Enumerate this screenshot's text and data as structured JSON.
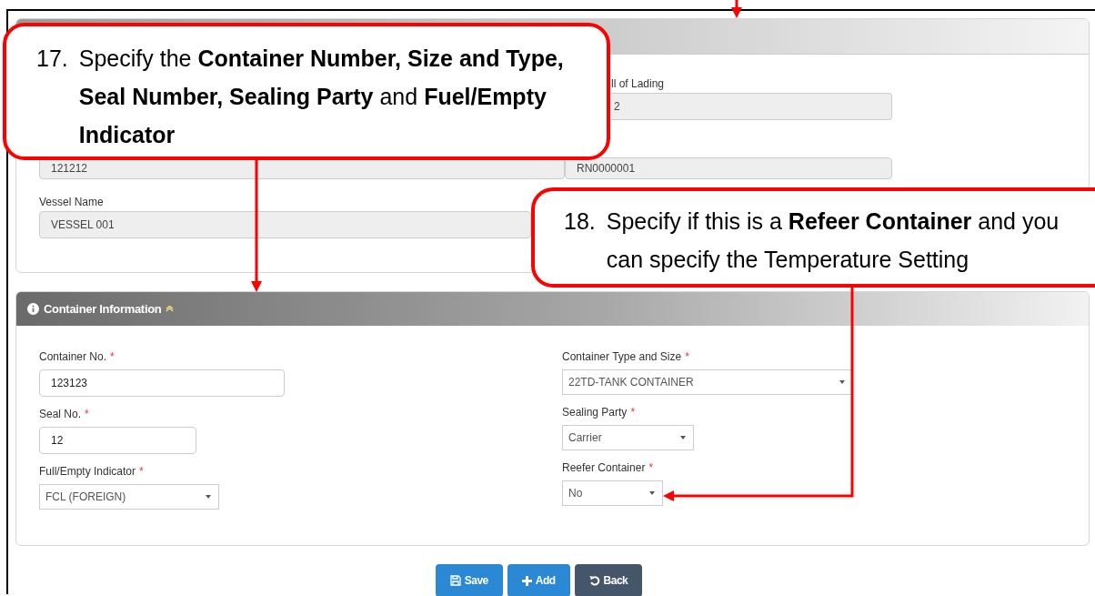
{
  "details_panel": {
    "rows": [
      {
        "right": {
          "label": "ll of Lading",
          "value": "2"
        }
      },
      {
        "left": {
          "value": "121212"
        },
        "right": {
          "value": "RN0000001"
        }
      },
      {
        "wide": {
          "label": "Vessel Name",
          "value": "VESSEL 001"
        }
      }
    ]
  },
  "container_panel": {
    "title": "Container Information",
    "expanded": true,
    "left_fields": [
      {
        "label": "Container No.",
        "required_mark": "*",
        "kind": "input",
        "value": "123123"
      },
      {
        "label": "Seal No.",
        "required_mark": "*",
        "kind": "input",
        "value": "12"
      },
      {
        "label": "Full/Empty Indicator",
        "required_mark": "*",
        "kind": "select",
        "value": "FCL (FOREIGN)"
      }
    ],
    "right_fields": [
      {
        "label": "Container Type and Size",
        "required_mark": "*",
        "kind": "select",
        "value": "22TD-TANK CONTAINER"
      },
      {
        "label": "Sealing Party",
        "required_mark": "*",
        "kind": "select",
        "value": "Carrier"
      },
      {
        "label": "Reefer Container",
        "required_mark": "*",
        "kind": "select",
        "value": "No"
      }
    ]
  },
  "buttons": [
    {
      "label": "Save",
      "kind": "save"
    },
    {
      "label": "Add",
      "kind": "add"
    },
    {
      "label": "Back",
      "kind": "back"
    }
  ],
  "callouts": [
    {
      "number": "17.",
      "text": "Specify the **Container Number, Size and Type, Seal Number, Sealing Party** and **Fuel/Empty Indicator**"
    },
    {
      "number": "18.",
      "text": "Specify if this is a **Refeer Container** and you can specify the Temperature Setting"
    }
  ]
}
